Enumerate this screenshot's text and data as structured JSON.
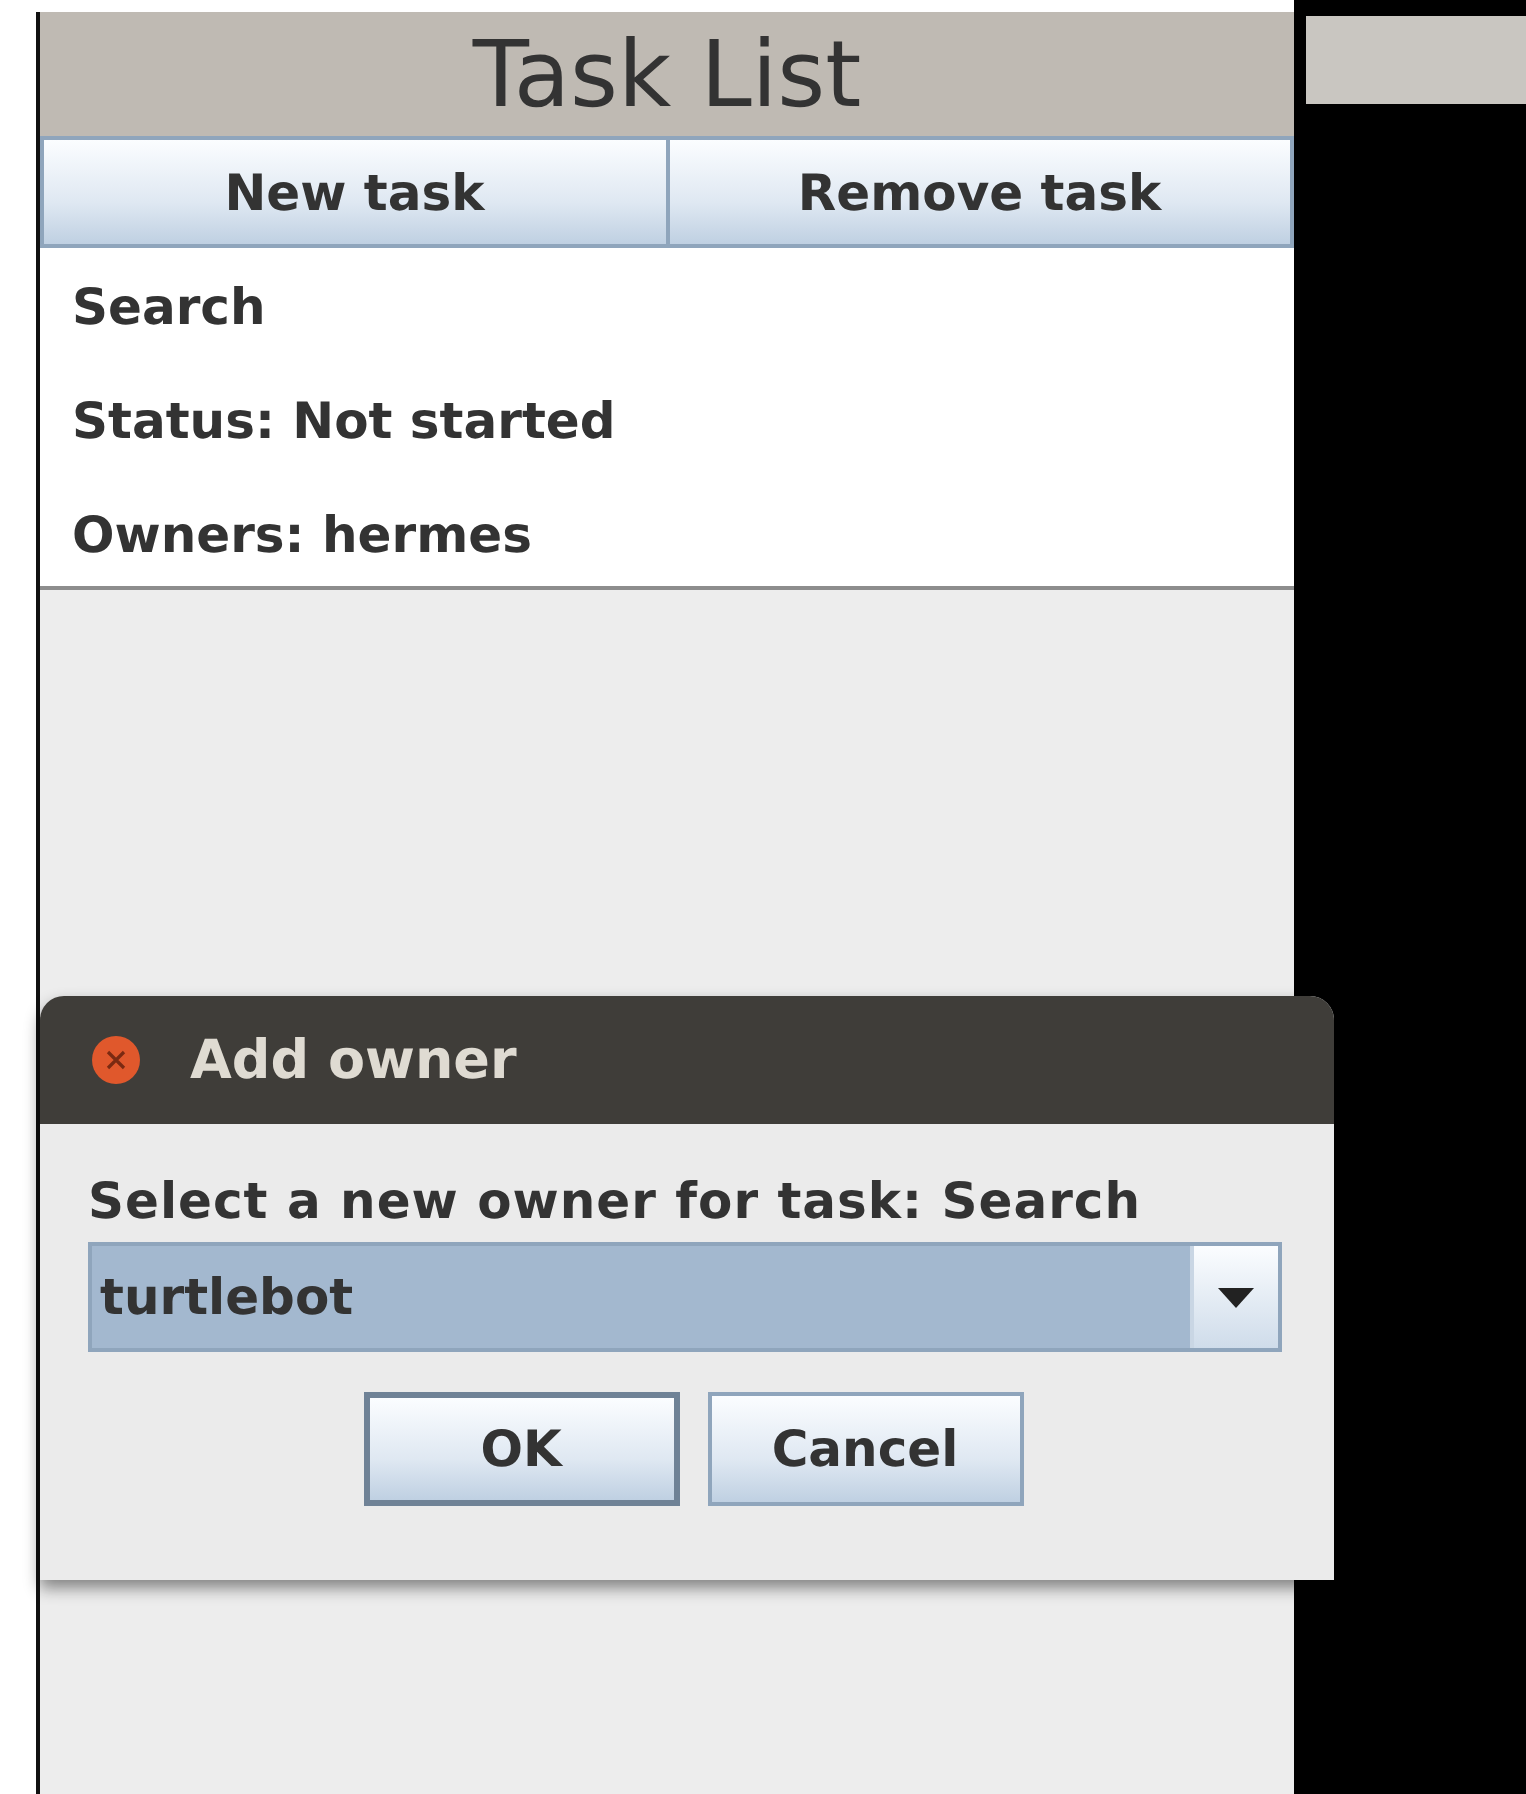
{
  "window": {
    "title": "Task List"
  },
  "toolbar": {
    "buttons": [
      "New task",
      "Remove task"
    ]
  },
  "task_details": [
    "Search",
    "Status: Not started",
    "Owners: hermes"
  ],
  "dialog": {
    "title": "Add owner",
    "prompt": "Select a new owner for task: Search",
    "owner_combo": {
      "value": "turtlebot"
    },
    "buttons": [
      {
        "label": "OK",
        "default": true
      },
      {
        "label": "Cancel",
        "default": false
      }
    ]
  }
}
